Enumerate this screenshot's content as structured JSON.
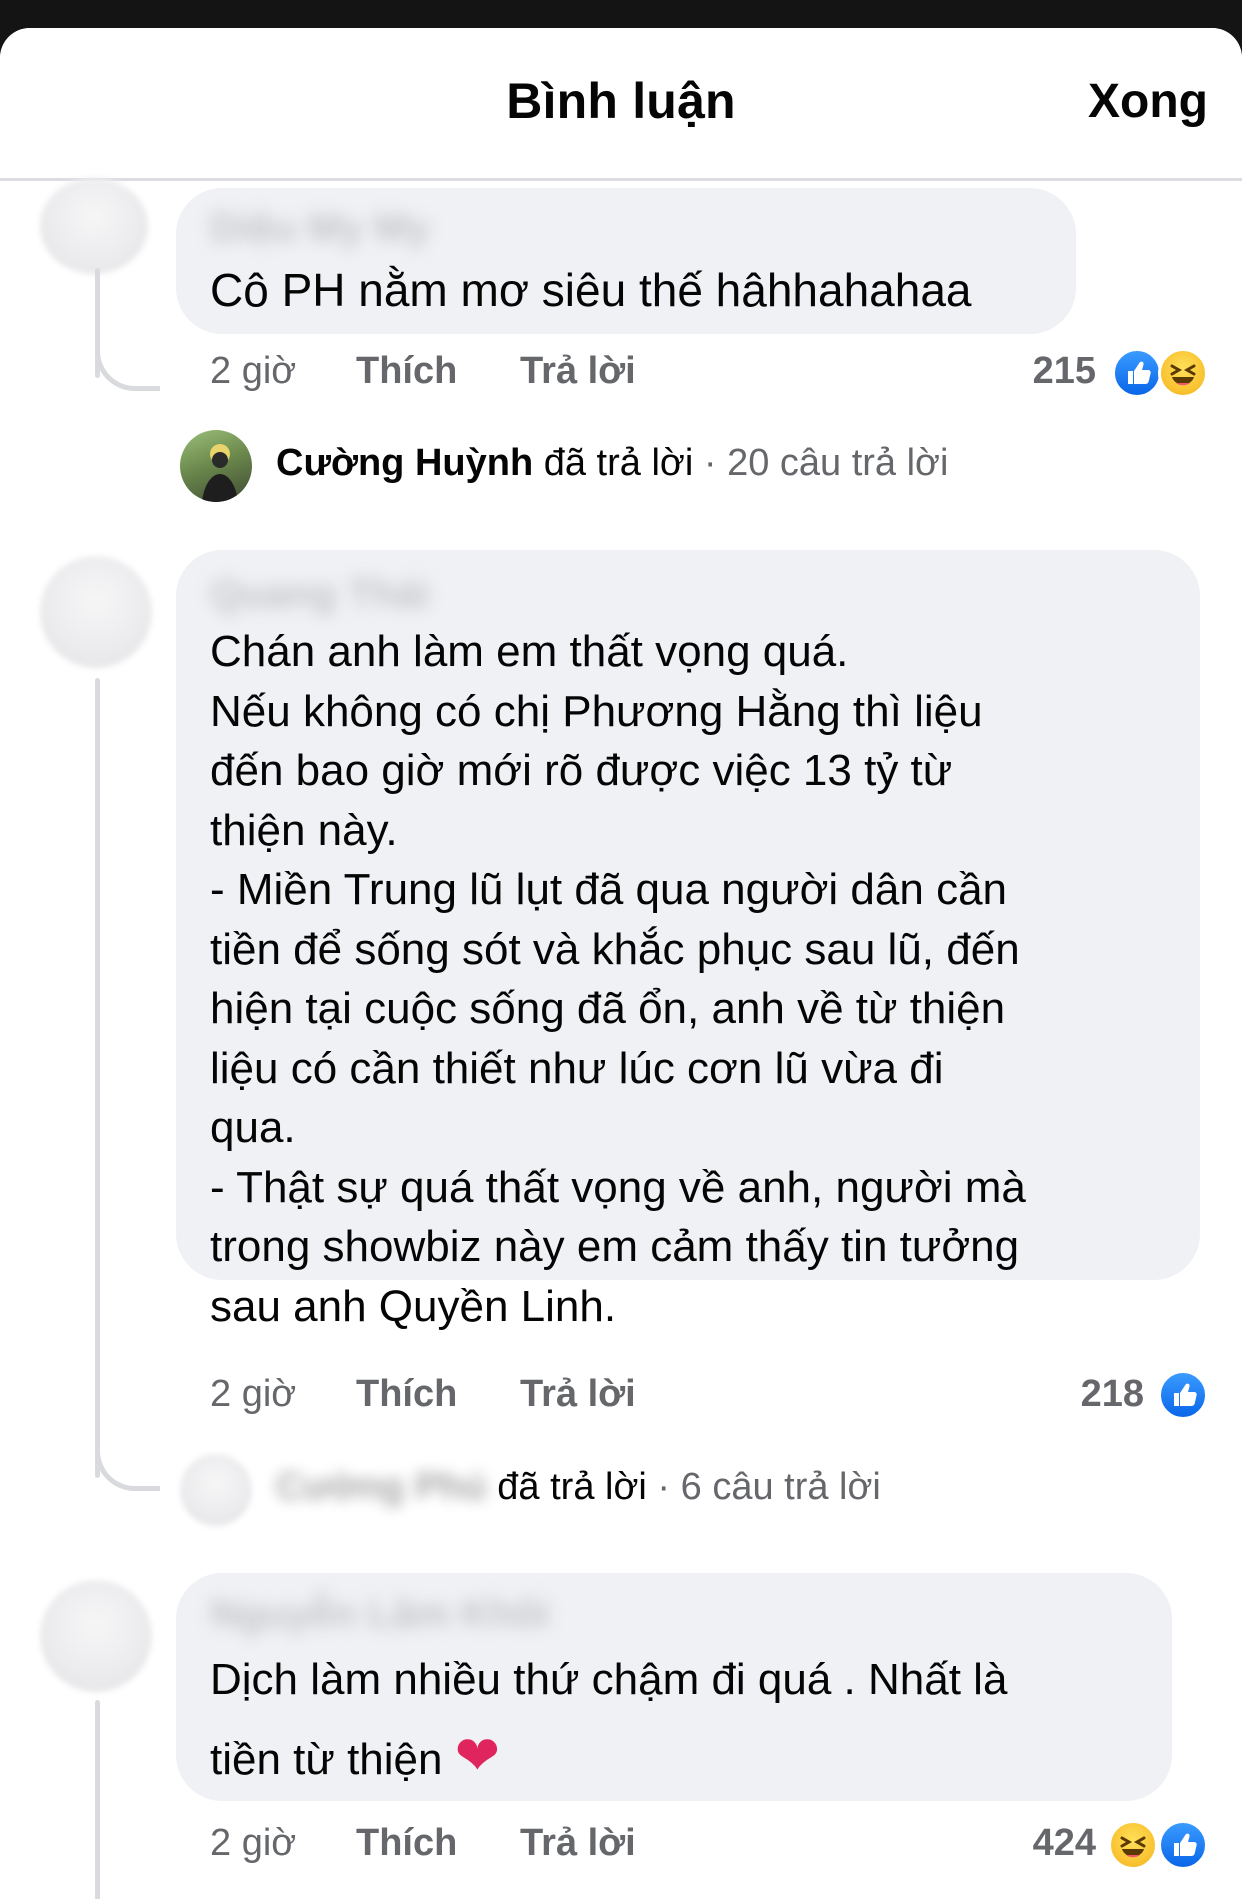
{
  "header": {
    "title": "Bình luận",
    "done_label": "Xong"
  },
  "comments": [
    {
      "author": "Diệu My My",
      "text": "Cô PH nằm mơ siêu thế hâhhahahaa",
      "time": "2 giờ",
      "like_label": "Thích",
      "reply_label": "Trả lời",
      "reaction_count": "215",
      "reactions": [
        "like-icon",
        "haha-icon"
      ],
      "reply_summary": {
        "name": "Cường Huỳnh",
        "verb": "đã trả lời",
        "dot": "·",
        "count": "20 câu trả lời"
      }
    },
    {
      "author": "Quang Thái",
      "text": "Chán anh làm em thất vọng quá.\nNếu không có chị Phương Hằng thì liệu\nđến bao giờ mới rõ được việc 13 tỷ từ\nthiện này.\n- Miền Trung lũ lụt đã qua người dân cần\ntiền để sống sót và khắc phục sau lũ, đến\nhiện tại cuộc sống đã ổn, anh về từ thiện\nliệu có cần thiết như lúc cơn lũ vừa đi\nqua.\n- Thật sự quá thất vọng về anh, người mà\ntrong showbiz này em cảm thấy tin tưởng\nsau anh Quyền Linh.",
      "time": "2 giờ",
      "like_label": "Thích",
      "reply_label": "Trả lời",
      "reaction_count": "218",
      "reactions": [
        "like-icon"
      ],
      "reply_summary": {
        "name": "Cường Phú",
        "verb": "đã trả lời",
        "dot": "·",
        "count": "6 câu trả lời"
      }
    },
    {
      "author": "Nguyễn Lâm Khôi",
      "text_line1": "Dịch làm nhiều thứ chậm đi quá . Nhất là",
      "text_line2": "tiền từ thiện",
      "emoji": "❤",
      "time": "2 giờ",
      "like_label": "Thích",
      "reply_label": "Trả lời",
      "reaction_count": "424",
      "reactions": [
        "haha-icon",
        "like-icon"
      ]
    }
  ],
  "colors": {
    "bubble": "#f0f1f4",
    "meta": "#65676b",
    "like_blue": "#0a66e8",
    "heart": "#e0245e"
  }
}
